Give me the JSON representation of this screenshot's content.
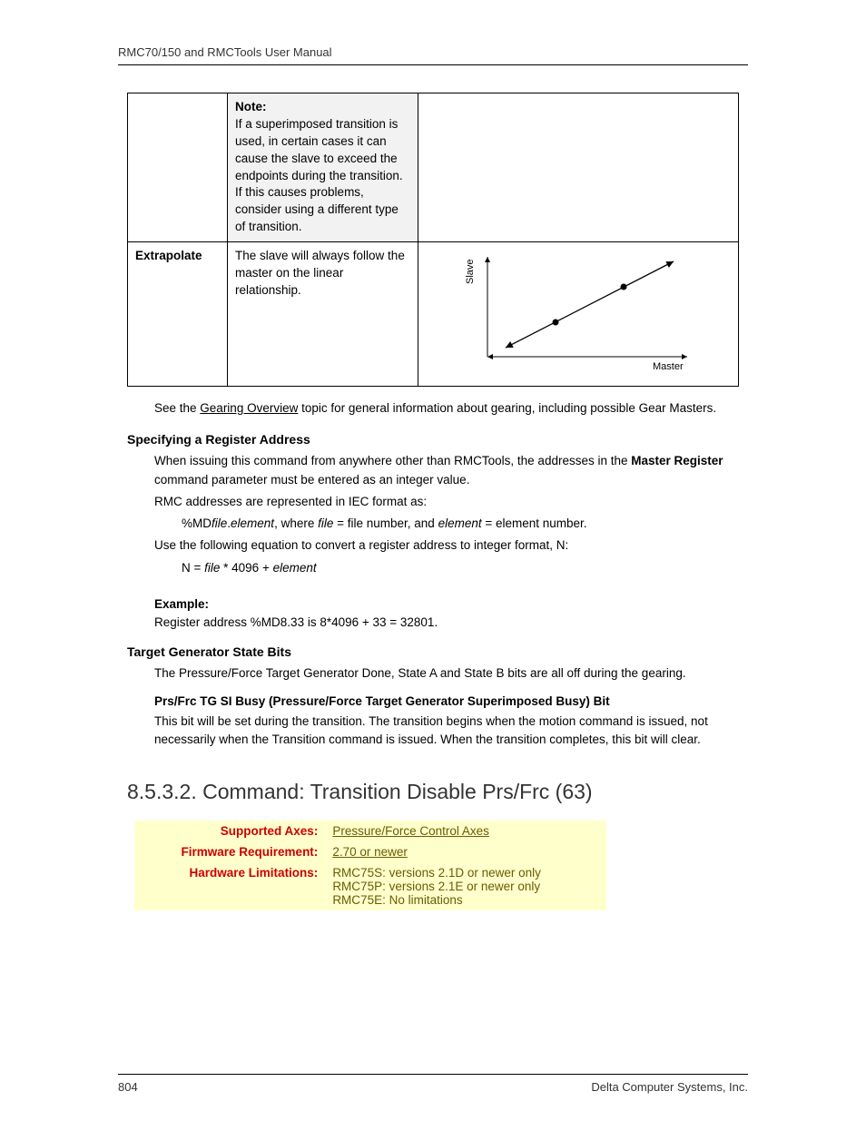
{
  "header": "RMC70/150 and RMCTools User Manual",
  "table": {
    "row1": {
      "note_label": "Note:",
      "note_text": "If a superimposed transition is used, in certain cases it can cause the slave to exceed the endpoints during the transition. If this causes problems, consider using a different type of transition."
    },
    "row2": {
      "label": "Extrapolate",
      "desc": "The slave will always follow the master on the linear relationship.",
      "graph": {
        "ylabel": "Slave",
        "xlabel": "Master"
      }
    }
  },
  "after_table": {
    "pre": "See the ",
    "link": "Gearing Overview",
    "post": " topic for general information about gearing, including possible Gear Masters."
  },
  "spec_head": "Specifying a Register Address",
  "spec_p1a": "When issuing this command from anywhere other than RMCTools, the addresses in the ",
  "spec_p1b": "Master Register",
  "spec_p1c": " command parameter must be entered as an integer value.",
  "spec_p2": "RMC addresses are represented in IEC format as:",
  "spec_fmt_a": "%MD",
  "spec_fmt_b": "file",
  "spec_fmt_c": ".",
  "spec_fmt_d": "element",
  "spec_fmt_e": ", where ",
  "spec_fmt_f": "file",
  "spec_fmt_g": " = file number, and ",
  "spec_fmt_h": "element",
  "spec_fmt_i": " = element number.",
  "spec_p3": "Use the following equation to convert a register address to integer format, N:",
  "spec_eq_a": "N =  ",
  "spec_eq_b": "file",
  "spec_eq_c": " * 4096 + ",
  "spec_eq_d": "element",
  "ex_head": "Example:",
  "ex_text": "Register address %MD8.33 is 8*4096 + 33 = 32801.",
  "tgs_head": "Target Generator State Bits",
  "tgs_p1": "The Pressure/Force Target Generator Done, State A and State B bits are all off during the gearing.",
  "tgs_sub": "Prs/Frc TG SI Busy (Pressure/Force Target Generator Superimposed Busy) Bit",
  "tgs_p2": "This bit will be set during the transition. The transition begins when the motion command is issued, not necessarily when the Transition command is issued. When the transition completes, this bit will clear.",
  "section_title": "8.5.3.2. Command: Transition Disable Prs/Frc (63)",
  "info": {
    "r1": {
      "label": "Supported Axes:",
      "value": "Pressure/Force Control Axes"
    },
    "r2": {
      "label": "Firmware Requirement:",
      "value": "2.70 or newer"
    },
    "r3": {
      "label": "Hardware Limitations:",
      "v1": "RMC75S: versions 2.1D or newer only",
      "v2": "RMC75P: versions 2.1E or newer only",
      "v3": "RMC75E: No limitations"
    }
  },
  "footer": {
    "page": "804",
    "company": "Delta Computer Systems, Inc."
  }
}
